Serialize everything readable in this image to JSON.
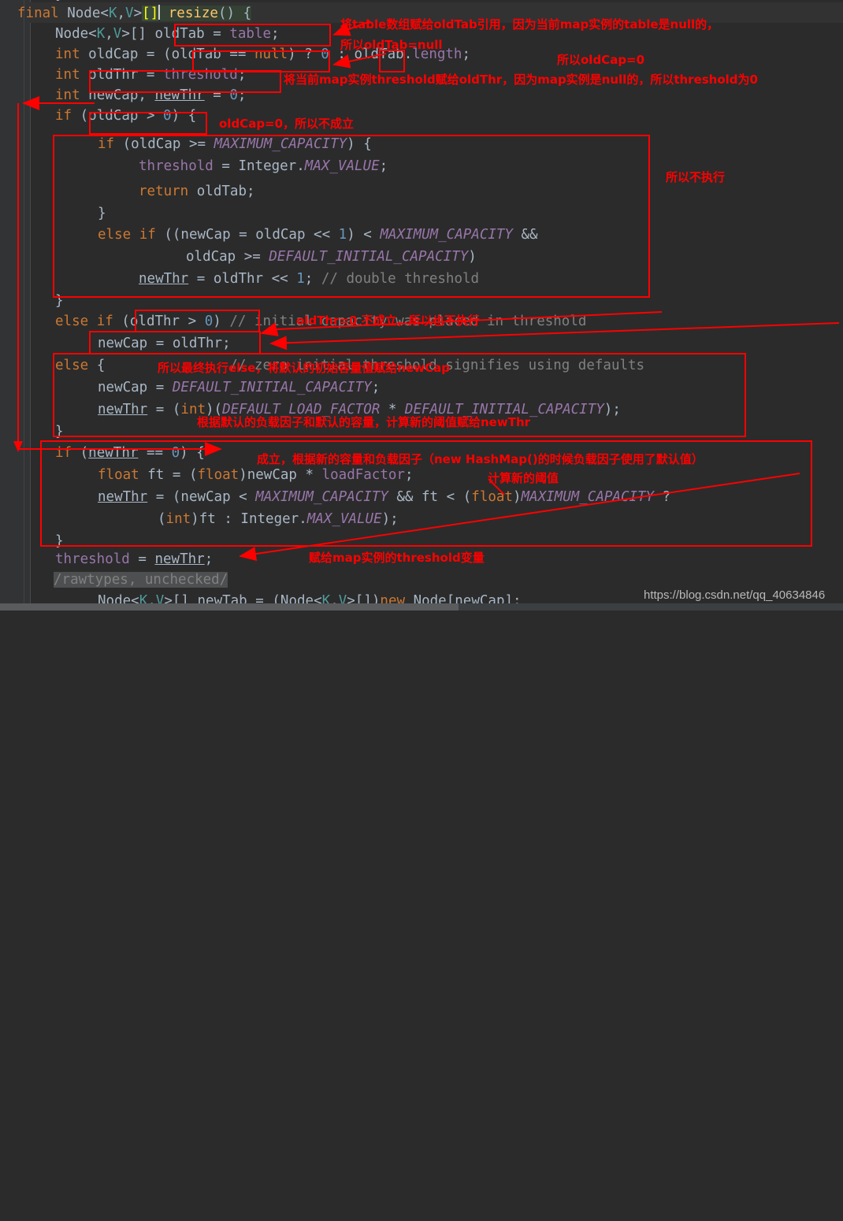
{
  "editor": {
    "background": "#2b2b2b",
    "gutter_color": "#313335",
    "annotation_color": "#fe0000",
    "lines": [
      {
        "indent": 0,
        "text": "}"
      },
      {
        "indent": 0,
        "text": "final Node<K,V>[] resize() {"
      },
      {
        "indent": 0,
        "text": "Node<K,V>[] oldTab = table;"
      },
      {
        "indent": 0,
        "text": "int oldCap = (oldTab == null) ? 0 : oldTab.length;"
      },
      {
        "indent": 0,
        "text": "int oldThr = threshold;"
      },
      {
        "indent": 0,
        "text": "int newCap, newThr = 0;"
      },
      {
        "indent": 0,
        "text": "if (oldCap > 0) {"
      },
      {
        "indent": 0,
        "text": "if (oldCap >= MAXIMUM_CAPACITY) {"
      },
      {
        "indent": 0,
        "text": "threshold = Integer.MAX_VALUE;"
      },
      {
        "indent": 0,
        "text": "return oldTab;"
      },
      {
        "indent": 0,
        "text": "}"
      },
      {
        "indent": 0,
        "text": "else if ((newCap = oldCap << 1) < MAXIMUM_CAPACITY &&"
      },
      {
        "indent": 0,
        "text": "oldCap >= DEFAULT_INITIAL_CAPACITY)"
      },
      {
        "indent": 0,
        "text": "newThr = oldThr << 1; // double threshold"
      },
      {
        "indent": 0,
        "text": "}"
      },
      {
        "indent": 0,
        "text": "else if (oldThr > 0) // initial capacity was placed in threshold"
      },
      {
        "indent": 0,
        "text": "newCap = oldThr;"
      },
      {
        "indent": 0,
        "text": "else {               // zero initial threshold signifies using defaults"
      },
      {
        "indent": 0,
        "text": "newCap = DEFAULT_INITIAL_CAPACITY;"
      },
      {
        "indent": 0,
        "text": "newThr = (int)(DEFAULT_LOAD_FACTOR * DEFAULT_INITIAL_CAPACITY);"
      },
      {
        "indent": 0,
        "text": "}"
      },
      {
        "indent": 0,
        "text": "if (newThr == 0) {"
      },
      {
        "indent": 0,
        "text": "float ft = (float)newCap * loadFactor;"
      },
      {
        "indent": 0,
        "text": "newThr = (newCap < MAXIMUM_CAPACITY && ft < (float)MAXIMUM_CAPACITY ?"
      },
      {
        "indent": 0,
        "text": "(int)ft : Integer.MAX_VALUE);"
      },
      {
        "indent": 0,
        "text": "}"
      },
      {
        "indent": 0,
        "text": "threshold = newThr;"
      },
      {
        "indent": 0,
        "text": "/rawtypes, unchecked/"
      },
      {
        "indent": 0,
        "text": "Node<K,V>[] newTab = (Node<K,V>[])new Node[newCap];"
      }
    ]
  },
  "annotations": [
    {
      "id": "a1",
      "text": "将table数组赋给oldTab引用，因为当前map实例的table是null的，"
    },
    {
      "id": "a2",
      "text": "所以oldTab=null"
    },
    {
      "id": "a3",
      "text": "所以oldCap=0"
    },
    {
      "id": "a4",
      "text": "将当前map实例threshold赋给oldThr，因为map实例是null的，所以threshold为0"
    },
    {
      "id": "a5",
      "text": "oldCap=0，所以不成立"
    },
    {
      "id": "a6",
      "text": "所以不执行"
    },
    {
      "id": "a7",
      "text": "oldThr=0 不成立，所以也不执行"
    },
    {
      "id": "a8",
      "text": "所以最终执行else，将默认的初始容量值赋给newCap"
    },
    {
      "id": "a9",
      "text": "根据默认的负载因子和默认的容量，计算新的阈值赋给newThr"
    },
    {
      "id": "a10",
      "text": "成立，根据新的容量和负载因子（new HashMap()的时候负载因子使用了默认值）"
    },
    {
      "id": "a11",
      "text": "计算新的阈值"
    },
    {
      "id": "a12",
      "text": "赋给map实例的threshold变量"
    }
  ],
  "watermark": {
    "text": "https://blog.csdn.net/qq_40634846"
  }
}
